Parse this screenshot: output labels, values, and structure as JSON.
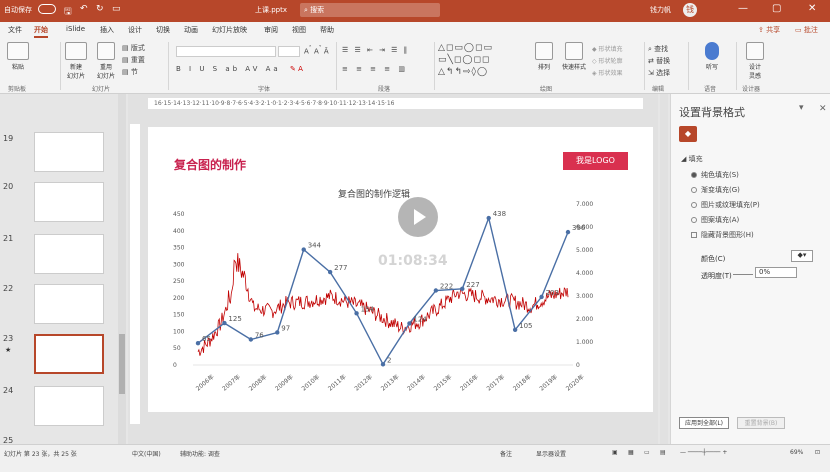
{
  "titlebar": {
    "autosave": "自动保存",
    "toggle_state": "关",
    "filename": "上课.pptx",
    "search": "搜索",
    "user": "钱力帆",
    "avatar": "钱"
  },
  "menu": {
    "tabs": [
      "文件",
      "开始",
      "iSlide",
      "插入",
      "设计",
      "切换",
      "动画",
      "幻灯片放映",
      "审阅",
      "视图",
      "帮助"
    ],
    "active": "开始",
    "share": "共享",
    "comment": "批注"
  },
  "ribbon": {
    "paste": "粘贴",
    "clipboard": "剪贴板",
    "new_slide": "新建\n幻灯片",
    "reuse": "重用\n幻灯片",
    "layout": "版式",
    "reset": "重置",
    "section": "节",
    "slides_group": "幻灯片",
    "font_group": "字体",
    "para_group": "段落",
    "drawing_group": "绘图",
    "arrange": "排列",
    "quick_styles": "快速样式",
    "fill": "形状填充",
    "outline": "形状轮廓",
    "effects": "形状效果",
    "find": "查找",
    "replace": "替换",
    "select": "选择",
    "editing_group": "编辑",
    "dictate": "听写",
    "voice_group": "语音",
    "designer": "设计\n灵感",
    "designer_group": "设计器"
  },
  "thumbnails": [
    {
      "num": "19"
    },
    {
      "num": "20"
    },
    {
      "num": "21"
    },
    {
      "num": "22"
    },
    {
      "num": "23"
    },
    {
      "num": "24"
    },
    {
      "num": "25"
    }
  ],
  "ruler": "16·15·14·13·12·11·10·9·8·7·6·5·4·3·2·1·0·1·2·3·4·5·6·7·8·9·10·11·12·13·14·15·16",
  "slide": {
    "title": "复合图的制作",
    "logo": "我是LOGO"
  },
  "video": {
    "timestamp": "01:08:34"
  },
  "chart_data": {
    "type": "line",
    "title": "复合图的制作逻辑",
    "categories": [
      "2006年",
      "2007年",
      "2008年",
      "2009年",
      "2010年",
      "2011年",
      "2012年",
      "2013年",
      "2014年",
      "2015年",
      "2016年",
      "2017年",
      "2018年",
      "2019年",
      "2020年"
    ],
    "series": [
      {
        "values": [
          65,
          125,
          76,
          97,
          344,
          277,
          154,
          2,
          124,
          222,
          227,
          438,
          105,
          203,
          396
        ]
      }
    ],
    "labels": [
      "65",
      "125",
      "76",
      "97",
      "344",
      "277",
      "154",
      "2",
      "124",
      "222",
      "227",
      "438",
      "105",
      "203",
      "396"
    ],
    "y_ticks": [
      "450",
      "400",
      "350",
      "300",
      "250",
      "200",
      "150",
      "100",
      "50",
      "0"
    ],
    "y2_ticks": [
      "7.000",
      "6.000",
      "5.000",
      "4.000",
      "3.000",
      "2.000",
      "1.000",
      "0"
    ],
    "ylim": [
      0,
      450
    ],
    "y2lim": [
      0,
      7
    ],
    "secondary_daily": "red line on right axis"
  },
  "pane": {
    "title": "设置背景格式",
    "fill_header": "填充",
    "options": [
      "纯色填充(S)",
      "渐变填充(G)",
      "图片或纹理填充(P)",
      "图案填充(A)",
      "隐藏背景图形(H)"
    ],
    "color_label": "颜色(C)",
    "transparency_label": "透明度(T)",
    "transparency_value": "0%",
    "apply_all": "应用到全部(L)",
    "reset_bg": "重置背景(B)"
  },
  "status": {
    "slide_info": "幻灯片 第 23 张，共 25 张",
    "lang": "中文(中国)",
    "accessibility": "辅助功能: 调查",
    "notes": "备注",
    "display": "显示器设置",
    "zoom": "69%"
  },
  "colors": {
    "accent": "#b7472a",
    "title": "#c8224f",
    "logo": "#d9304f",
    "line_blue": "#4a6fa5",
    "line_red": "#c00000"
  }
}
